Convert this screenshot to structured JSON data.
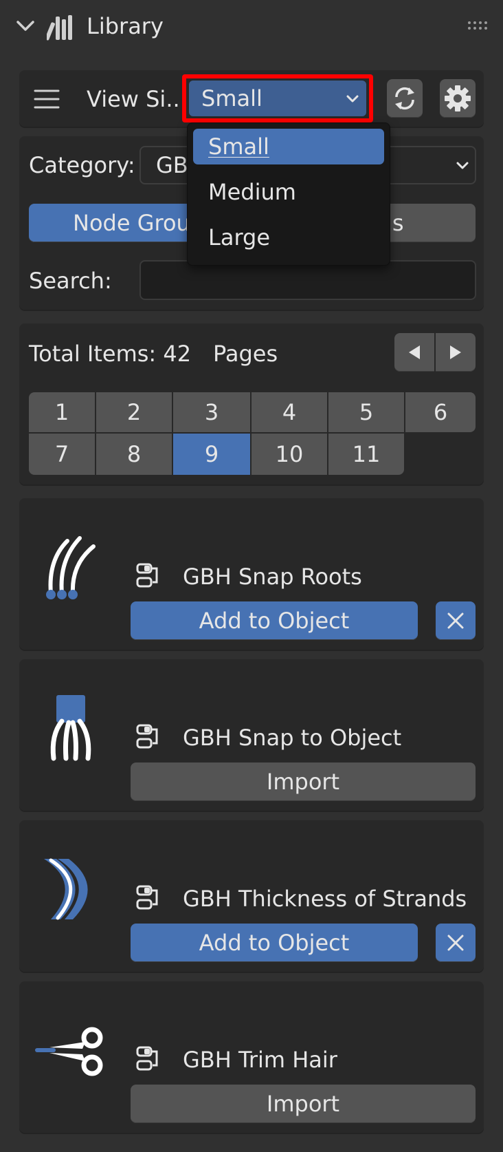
{
  "header": {
    "title": "Library",
    "collapse_icon": "chevron-down-icon",
    "library_icon": "library-books-icon",
    "grip_icon": "drag-grip-icon"
  },
  "toolbar": {
    "view_size_label": "View Si...",
    "view_size_value": "Small",
    "menu_icon": "hamburger-menu-icon",
    "refresh_icon": "refresh-icon",
    "settings_icon": "gear-icon"
  },
  "dropdown": {
    "options": [
      "Small",
      "Medium",
      "Large"
    ],
    "selected": "Small"
  },
  "filters": {
    "category_label": "Category:",
    "category_value": "GB",
    "tab_left": "Node Group",
    "tab_right": "ls",
    "search_label": "Search:",
    "search_value": ""
  },
  "pagination": {
    "total_label": "Total Items: 42",
    "pages_label": "Pages",
    "pages": [
      "1",
      "2",
      "3",
      "4",
      "5",
      "6",
      "7",
      "8",
      "9",
      "10",
      "11"
    ],
    "current_page": "9"
  },
  "items": [
    {
      "name": "GBH Snap Roots",
      "action": "Add to Object",
      "removable": true,
      "icon": "hair-snap-roots-icon"
    },
    {
      "name": "GBH Snap to Object",
      "action": "Import",
      "removable": false,
      "icon": "hair-snap-object-icon"
    },
    {
      "name": "GBH Thickness of Strands",
      "action": "Add to Object",
      "removable": true,
      "icon": "hair-thickness-icon"
    },
    {
      "name": "GBH Trim Hair",
      "action": "Import",
      "removable": false,
      "icon": "scissors-icon"
    }
  ],
  "colors": {
    "accent": "#4772b3",
    "highlight": "#ff0000",
    "background": "#303030",
    "panel": "#282828"
  }
}
